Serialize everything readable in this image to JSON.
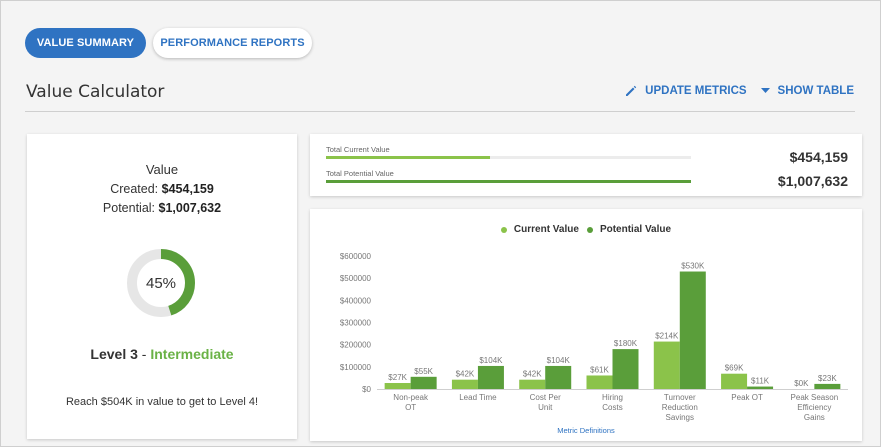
{
  "tabs": {
    "active": "VALUE SUMMARY",
    "inactive": "PERFORMANCE REPORTS"
  },
  "header": {
    "title": "Value Calculator",
    "update_metrics": "UPDATE METRICS",
    "show_table": "SHOW TABLE"
  },
  "summary": {
    "title": "Value",
    "created_label": "Created:",
    "created_value": "$454,159",
    "potential_label": "Potential:",
    "potential_value": "$1,007,632",
    "percent_text": "45%",
    "percent_value": 0.45,
    "level_text": "Level 3",
    "level_sep": "-",
    "level_name": "Intermediate",
    "reach_text": "Reach $504K in value to get to Level 4!"
  },
  "totals": {
    "current_label": "Total Current Value",
    "current_value": "$454,159",
    "current_fraction": 0.45,
    "potential_label": "Total Potential Value",
    "potential_value": "$1,007,632",
    "potential_fraction": 1.0
  },
  "colors": {
    "accent": "#2f73c2",
    "current": "#8bc34a",
    "potential": "#5a9e3a",
    "level": "#6ab246",
    "donut_track": "#e6e6e6"
  },
  "chart_data": {
    "type": "bar",
    "categories": [
      [
        "Non-peak",
        "OT"
      ],
      [
        "Lead Time"
      ],
      [
        "Cost Per",
        "Unit"
      ],
      [
        "Hiring",
        "Costs"
      ],
      [
        "Turnover",
        "Reduction",
        "Savings"
      ],
      [
        "Peak OT"
      ],
      [
        "Peak Season",
        "Efficiency",
        "Gains"
      ]
    ],
    "series": [
      {
        "name": "Current Value",
        "values": [
          27000,
          42000,
          42000,
          61000,
          214000,
          69000,
          0
        ],
        "labels": [
          "$27K",
          "$42K",
          "$42K",
          "$61K",
          "$214K",
          "$69K",
          "$0K"
        ]
      },
      {
        "name": "Potential Value",
        "values": [
          55000,
          104000,
          104000,
          180000,
          530000,
          11000,
          23000
        ],
        "labels": [
          "$55K",
          "$104K",
          "$104K",
          "$180K",
          "$530K",
          "$11K",
          "$23K"
        ]
      }
    ],
    "yticks": [
      "$0",
      "$100000",
      "$200000",
      "$300000",
      "$400000",
      "$500000",
      "$600000"
    ],
    "ylim": [
      0,
      600000
    ],
    "legend_position": "top",
    "grid": false,
    "footer_link": "Metric Definitions"
  }
}
